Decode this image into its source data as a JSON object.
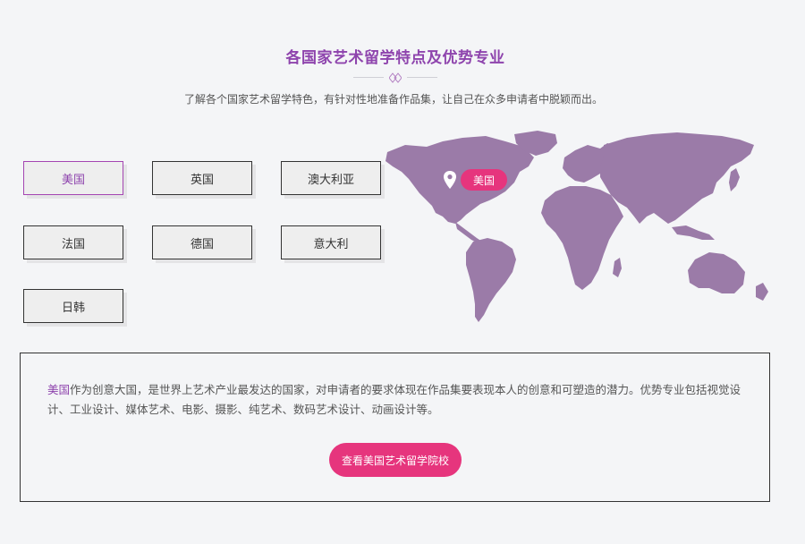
{
  "section": {
    "title": "各国家艺术留学特点及优势专业",
    "subtitle": "了解各个国家艺术留学特色，有针对性地准备作品集，让自己在众多申请者中脱颖而出。"
  },
  "tabs": [
    {
      "label": "美国",
      "active": true
    },
    {
      "label": "英国",
      "active": false
    },
    {
      "label": "澳大利亚",
      "active": false
    },
    {
      "label": "法国",
      "active": false
    },
    {
      "label": "德国",
      "active": false
    },
    {
      "label": "意大利",
      "active": false
    },
    {
      "label": "日韩",
      "active": false
    }
  ],
  "map": {
    "pin_label": "美国",
    "pin_icon": "map-pin-icon",
    "land_color": "#9b7ba8"
  },
  "detail": {
    "country": "美国",
    "text": "作为创意大国，是世界上艺术产业最发达的国家，对申请者的要求体现在作品集要表现本人的创意和可塑造的潜力。优势专业包括视觉设计、工业设计、媒体艺术、电影、摄影、纯艺术、数码艺术设计、动画设计等。",
    "cta_label": "查看美国艺术留学院校"
  },
  "colors": {
    "accent": "#8e44ad",
    "button": "#e6357d",
    "background": "#f4f5f7"
  }
}
